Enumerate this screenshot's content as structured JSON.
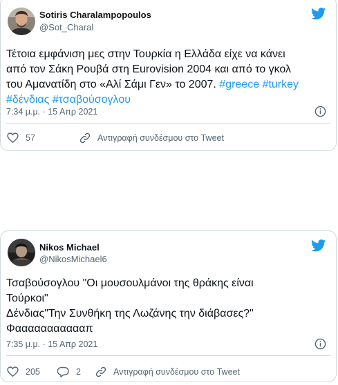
{
  "tweets": [
    {
      "author_name": "Sotiris Charalampopoulos",
      "handle": "@Sot_Charal",
      "text_lines": [
        "Τέτοια εμφάνιση μες στην Τουρκία η Ελλάδα είχε να κάνει",
        "από τον Σάκη Ρουβά στη Eurovision 2004 και από το γκολ",
        "του Αμανατίδη στο «Αλί Σάμι Γεν» το 2007. "
      ],
      "hashtags_line3": [
        "#greece",
        "#turkey"
      ],
      "hashtags_line4": [
        "#δένδιας",
        "#τσαβούσογλου"
      ],
      "timestamp": "7:34 μ.μ. · 15 Απρ 2021",
      "likes": "57",
      "copy_link_label": "Αντιγραφή συνδέσμου στο Tweet"
    },
    {
      "author_name": "Nikos Michael",
      "handle": "@NikosMichael6",
      "text_lines": [
        "Τσαβούσογλου \"Οι μουσουλμάνοι της θράκης είναι",
        "Τούρκοι\"",
        "Δένδιας\"Την Συνθήκη της Λωζάνης την διάβασες?\"",
        "Φαααααααααααπ"
      ],
      "timestamp": "7:35 μ.μ. · 15 Απρ 2021",
      "likes": "205",
      "replies": "2",
      "copy_link_label": "Αντιγραφή συνδέσμου στο Tweet"
    }
  ],
  "colors": {
    "brand_blue": "#1d9bf0",
    "text_primary": "#0f1419",
    "text_secondary": "#536471",
    "border": "#cfd9de"
  },
  "icons": [
    "twitter-bird-icon",
    "info-icon",
    "heart-icon",
    "reply-icon",
    "link-icon"
  ]
}
